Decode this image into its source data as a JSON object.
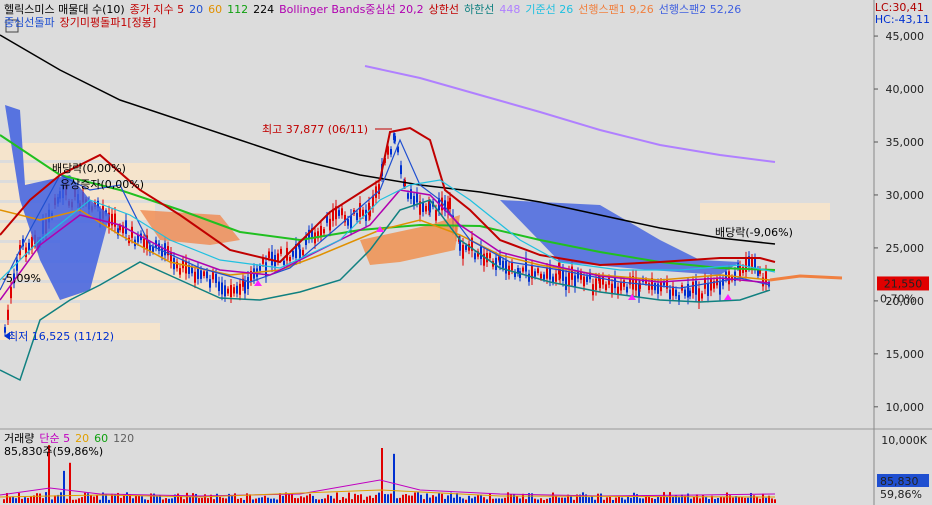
{
  "price_legend": {
    "title": "헬릭스미스 매물대 수(10)",
    "items": [
      {
        "text": "종가 지수 5",
        "color": "#c00000"
      },
      {
        "text": "20",
        "color": "#1f4fd0"
      },
      {
        "text": "60",
        "color": "#e09000"
      },
      {
        "text": "112",
        "color": "#10a010"
      },
      {
        "text": "224",
        "color": "#000000"
      },
      {
        "text": "Bollinger Bands중심선 20,2",
        "color": "#b000b0"
      },
      {
        "text": "상한선",
        "color": "#c00000"
      },
      {
        "text": "하한선",
        "color": "#108080"
      },
      {
        "text": "448",
        "color": "#b080ff"
      },
      {
        "text": "기준선 26",
        "color": "#20c0e0"
      },
      {
        "text": "선행스팬1 9,26",
        "color": "#f08040"
      },
      {
        "text": "선행스팬2 52,26",
        "color": "#4060e0"
      }
    ],
    "line2": [
      {
        "text": "중심선돌파",
        "color": "#1f4fd0"
      },
      {
        "text": "장기미평돌파1[정봉]",
        "color": "#c00000"
      }
    ]
  },
  "corner": {
    "lc": "LC:30,41",
    "hc": "HC:-43,11"
  },
  "annotations": {
    "high": "최고 37,877 (06/11)",
    "low": "최저 16,525 (11/12)",
    "ex_div_right": "배당락(-9,06%)",
    "ex_div_left": "배당락(0,00%)",
    "rights_left": "유상증자(0,00%)",
    "pct_left": "-5,09%"
  },
  "price_axis": {
    "ticks": [
      "45,000",
      "40,000",
      "35,000",
      "30,000",
      "25,000",
      "20,000",
      "15,000",
      "10,000"
    ],
    "current_price": "21,550",
    "current_change": "0,70%"
  },
  "volume_legend": {
    "title": "거래량",
    "items": [
      {
        "text": "단순 5",
        "color": "#c000c0"
      },
      {
        "text": "20",
        "color": "#e0a000"
      },
      {
        "text": "60",
        "color": "#10a010"
      },
      {
        "text": "120",
        "color": "#606060"
      }
    ],
    "value_line": "85,830주(59,86%)"
  },
  "volume_axis": {
    "top": "10,000K",
    "current": "85,830",
    "pct": "59,86%"
  },
  "colors": {
    "up": "#e00000",
    "down": "#0030d0",
    "bg": "#dcdcdc",
    "cloud": "#4060e0"
  },
  "chart_data": {
    "type": "line",
    "title": "헬릭스미스",
    "ylim": [
      8000,
      48000
    ],
    "x": [
      "11/12",
      "06/11"
    ],
    "y": [
      16525,
      37877
    ],
    "current": 21550,
    "volume_current": 85830
  }
}
